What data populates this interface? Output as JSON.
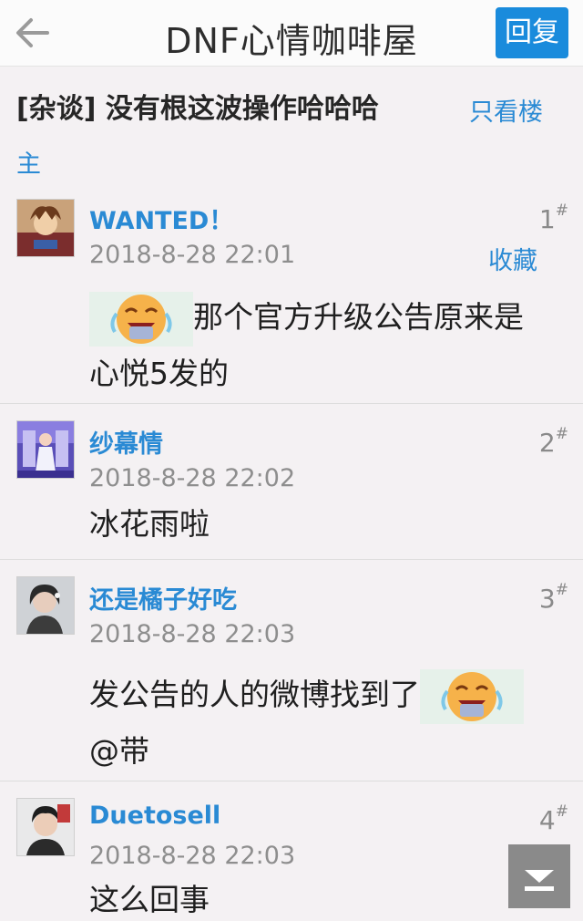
{
  "header": {
    "title": "DNF心情咖啡屋",
    "reply_label": "回复"
  },
  "thread": {
    "title": "[杂谈] 没有根这波操作哈哈哈",
    "only_op_part1": "只看楼",
    "only_op_part2": "主"
  },
  "posts": [
    {
      "author": "WANTED！",
      "floor": "1",
      "time": "2018-8-28 22:01",
      "favorite_label": "收藏",
      "content_line1": "那个官方升级公告原来是",
      "content_line2": "心悦5发的"
    },
    {
      "author": "纱幕情",
      "floor": "2",
      "time": "2018-8-28 22:02",
      "content_line1": "冰花雨啦"
    },
    {
      "author": "还是橘子好吃",
      "floor": "3",
      "time": "2018-8-28 22:03",
      "content_line1": "发公告的人的微博找到了",
      "content_line2": "@带"
    },
    {
      "author": "Duetosell",
      "floor": "4",
      "time": "2018-8-28 22:03",
      "content_line1": "这么回事"
    }
  ],
  "floor_mark": "#",
  "colors": {
    "accent": "#2a8ad4",
    "reply_button": "#1a8bdc",
    "background": "#f4f1f3"
  }
}
